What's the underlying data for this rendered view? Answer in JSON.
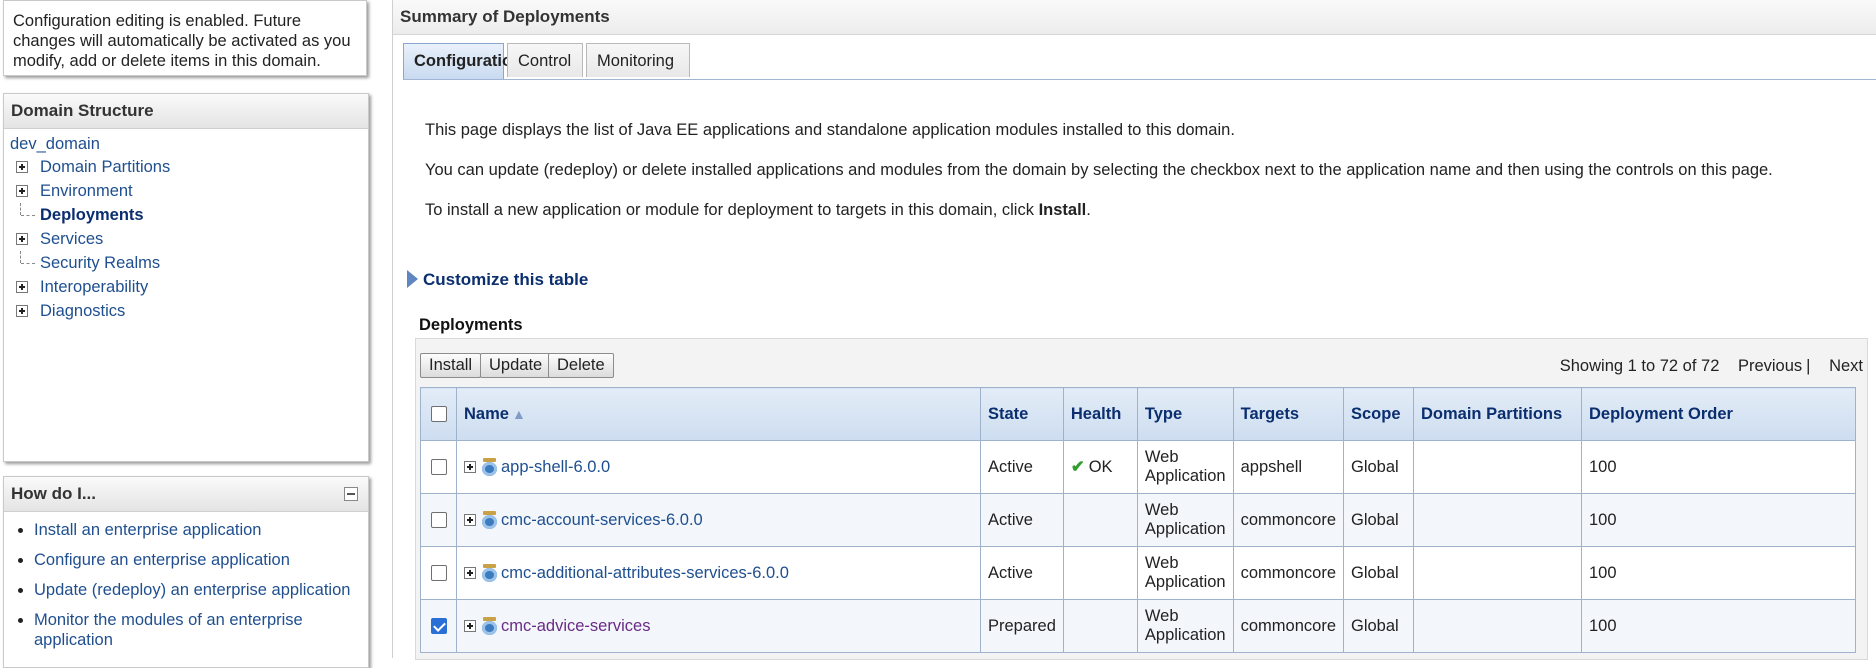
{
  "change_center": {
    "message": "Configuration editing is enabled. Future changes will automatically be activated as you modify, add or delete items in this domain."
  },
  "domain_structure": {
    "title": "Domain Structure",
    "root": "dev_domain",
    "items": [
      {
        "label": "Domain Partitions",
        "expandable": true
      },
      {
        "label": "Environment",
        "expandable": true
      },
      {
        "label": "Deployments",
        "expandable": false,
        "selected": true
      },
      {
        "label": "Services",
        "expandable": true
      },
      {
        "label": "Security Realms",
        "expandable": false
      },
      {
        "label": "Interoperability",
        "expandable": true
      },
      {
        "label": "Diagnostics",
        "expandable": true
      }
    ]
  },
  "how_do_i": {
    "title": "How do I...",
    "items": [
      "Install an enterprise application",
      "Configure an enterprise application",
      "Update (redeploy) an enterprise application",
      "Monitor the modules of an enterprise application"
    ]
  },
  "summary": {
    "title": "Summary of Deployments",
    "tabs": [
      "Configuration",
      "Control",
      "Monitoring"
    ],
    "active_tab": "Configuration",
    "intro_1": "This page displays the list of Java EE applications and standalone application modules installed to this domain.",
    "intro_2": "You can update (redeploy) or delete installed applications and modules from the domain by selecting the checkbox next to the application name and then using the controls on this page.",
    "intro_3_prefix": "To install a new application or module for deployment to targets in this domain, click ",
    "intro_3_bold": "Install",
    "intro_3_suffix": ".",
    "customize_label": "Customize this table"
  },
  "deployments": {
    "title": "Deployments",
    "buttons": {
      "install": "Install",
      "update": "Update",
      "delete": "Delete"
    },
    "pager": {
      "showing": "Showing 1 to 72 of 72",
      "previous": "Previous",
      "separator": "|",
      "next": "Next"
    },
    "columns": [
      "Name",
      "State",
      "Health",
      "Type",
      "Targets",
      "Scope",
      "Domain Partitions",
      "Deployment Order"
    ],
    "rows": [
      {
        "checked": false,
        "name": "app-shell-6.0.0",
        "state": "Active",
        "health": "OK",
        "type_1": "Web",
        "type_2": "Application",
        "targets": "appshell",
        "scope": "Global",
        "partitions": "",
        "order": "100"
      },
      {
        "checked": false,
        "name": "cmc-account-services-6.0.0",
        "state": "Active",
        "health": "",
        "type_1": "Web",
        "type_2": "Application",
        "targets": "commoncore",
        "scope": "Global",
        "partitions": "",
        "order": "100"
      },
      {
        "checked": false,
        "name": "cmc-additional-attributes-services-6.0.0",
        "state": "Active",
        "health": "",
        "type_1": "Web",
        "type_2": "Application",
        "targets": "commoncore",
        "scope": "Global",
        "partitions": "",
        "order": "100"
      },
      {
        "checked": true,
        "name": "cmc-advice-services",
        "state": "Prepared",
        "health": "",
        "type_1": "Web",
        "type_2": "Application",
        "targets": "commoncore",
        "scope": "Global",
        "partitions": "",
        "order": "100"
      }
    ]
  }
}
